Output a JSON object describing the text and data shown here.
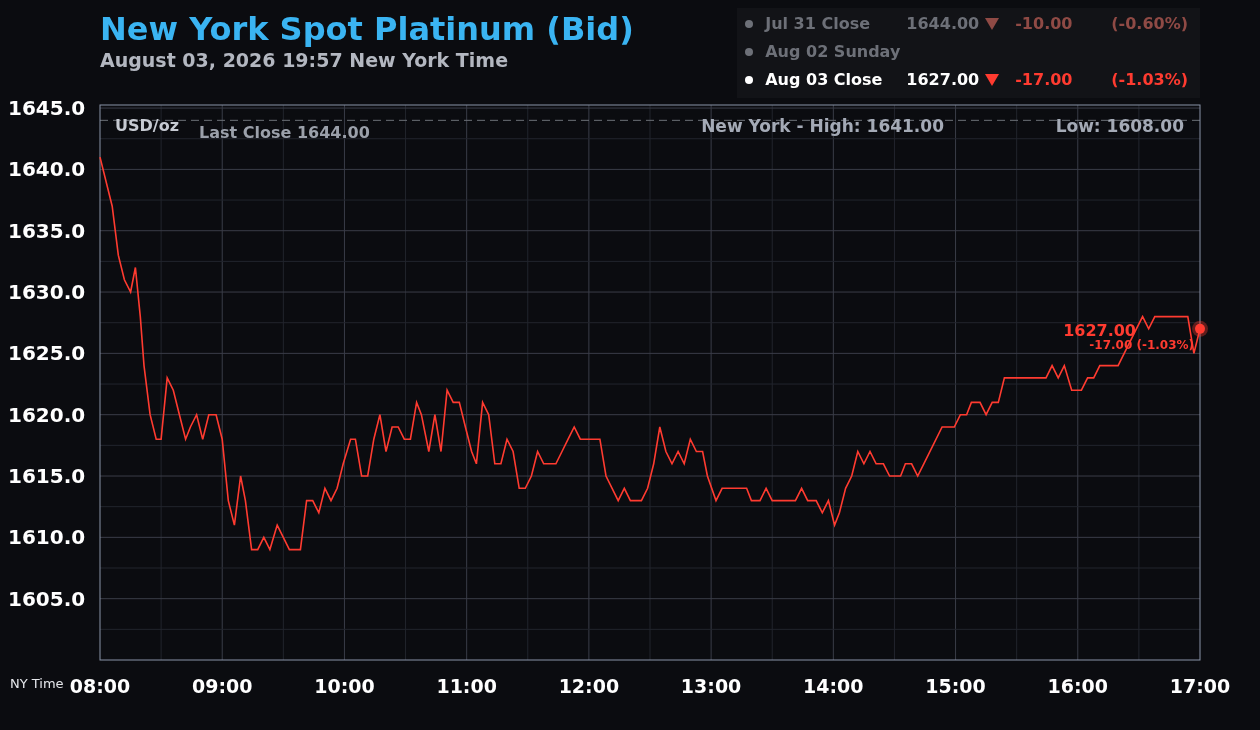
{
  "title": "New York Spot Platinum (Bid)",
  "subtitle": "August 03, 2026 19:57 New York Time",
  "legend": [
    {
      "label": "Jul 31 Close",
      "value": "1644.00",
      "change": "-10.00",
      "percent": "(-0.60%)",
      "active": false
    },
    {
      "label": "Aug 02 Sunday",
      "active": false
    },
    {
      "label": "Aug 03 Close",
      "value": "1627.00",
      "change": "-17.00",
      "percent": "(-1.03%)",
      "active": true
    }
  ],
  "chart": {
    "unit": "USD/oz",
    "high": "New York - High: 1641.00",
    "low": "Low: 1608.00",
    "x_axis_label": "NY Time",
    "end_value": "1627.00",
    "end_change": "-17.00 (-1.03%)",
    "chart_data": {
      "type": "line",
      "xlim": [
        8,
        17
      ],
      "ylim": [
        1600,
        1645.25
      ],
      "xticks": [
        {
          "value": 8,
          "label": "08:00"
        },
        {
          "value": 9,
          "label": "09:00"
        },
        {
          "value": 10,
          "label": "10:00"
        },
        {
          "value": 11,
          "label": "11:00"
        },
        {
          "value": 12,
          "label": "12:00"
        },
        {
          "value": 13,
          "label": "13:00"
        },
        {
          "value": 14,
          "label": "14:00"
        },
        {
          "value": 15,
          "label": "15:00"
        },
        {
          "value": 16,
          "label": "16:00"
        },
        {
          "value": 17,
          "label": "17:00"
        }
      ],
      "yticks": [
        {
          "value": 1605,
          "label": "1605.0"
        },
        {
          "value": 1610,
          "label": "1610.0"
        },
        {
          "value": 1615,
          "label": "1615.0"
        },
        {
          "value": 1620,
          "label": "1620.0"
        },
        {
          "value": 1625,
          "label": "1625.0"
        },
        {
          "value": 1630,
          "label": "1630.0"
        },
        {
          "value": 1635,
          "label": "1635.0"
        },
        {
          "value": 1640,
          "label": "1640.0"
        },
        {
          "value": 1645,
          "label": "1645.0"
        }
      ],
      "grid": true,
      "ref_lines": [
        {
          "axis": "y",
          "value": 1644,
          "label": "Last Close 1644.00"
        }
      ],
      "x": [
        8.0,
        8.1,
        8.15,
        8.2,
        8.25,
        8.29,
        8.33,
        8.36,
        8.41,
        8.46,
        8.5,
        8.55,
        8.6,
        8.65,
        8.7,
        8.74,
        8.79,
        8.84,
        8.89,
        8.95,
        9.0,
        9.05,
        9.1,
        9.15,
        9.19,
        9.24,
        9.29,
        9.34,
        9.39,
        9.45,
        9.5,
        9.55,
        9.64,
        9.69,
        9.74,
        9.79,
        9.84,
        9.89,
        9.94,
        9.99,
        10.05,
        10.09,
        10.14,
        10.19,
        10.24,
        10.29,
        10.34,
        10.39,
        10.44,
        10.49,
        10.54,
        10.59,
        10.63,
        10.69,
        10.74,
        10.79,
        10.84,
        10.89,
        10.94,
        10.99,
        11.04,
        11.08,
        11.13,
        11.18,
        11.23,
        11.28,
        11.33,
        11.38,
        11.43,
        11.48,
        11.53,
        11.58,
        11.63,
        11.73,
        11.78,
        11.83,
        11.88,
        11.93,
        12.09,
        12.14,
        12.19,
        12.24,
        12.29,
        12.34,
        12.43,
        12.48,
        12.53,
        12.58,
        12.63,
        12.68,
        12.73,
        12.78,
        12.83,
        12.88,
        12.93,
        12.97,
        13.04,
        13.09,
        13.29,
        13.33,
        13.4,
        13.45,
        13.5,
        13.69,
        13.74,
        13.79,
        13.86,
        13.91,
        13.96,
        14.01,
        14.05,
        14.1,
        14.15,
        14.2,
        14.25,
        14.3,
        14.35,
        14.41,
        14.46,
        14.55,
        14.59,
        14.64,
        14.69,
        14.74,
        14.89,
        14.99,
        15.04,
        15.09,
        15.13,
        15.2,
        15.25,
        15.3,
        15.35,
        15.4,
        15.74,
        15.79,
        15.84,
        15.89,
        15.95,
        16.03,
        16.08,
        16.13,
        16.18,
        16.33,
        16.38,
        16.43,
        16.48,
        16.53,
        16.58,
        16.63,
        16.9,
        16.95,
        17.0
      ],
      "series": [
        {
          "color": "#ff3b30",
          "values": [
            1641,
            1637,
            1633,
            1631,
            1630,
            1632,
            1628,
            1624,
            1620,
            1618,
            1618,
            1623,
            1622,
            1620,
            1618,
            1619,
            1620,
            1618,
            1620,
            1620,
            1618,
            1613,
            1611,
            1615,
            1613,
            1609,
            1609,
            1610,
            1609,
            1611,
            1610,
            1609,
            1609,
            1613,
            1613,
            1612,
            1614,
            1613,
            1614,
            1616,
            1618,
            1618,
            1615,
            1615,
            1618,
            1620,
            1617,
            1619,
            1619,
            1618,
            1618,
            1621,
            1620,
            1617,
            1620,
            1617,
            1622,
            1621,
            1621,
            1619,
            1617,
            1616,
            1621,
            1620,
            1616,
            1616,
            1618,
            1617,
            1614,
            1614,
            1615,
            1617,
            1616,
            1616,
            1617,
            1618,
            1619,
            1618,
            1618,
            1615,
            1614,
            1613,
            1614,
            1613,
            1613,
            1614,
            1616,
            1619,
            1617,
            1616,
            1617,
            1616,
            1618,
            1617,
            1617,
            1615,
            1613,
            1614,
            1614,
            1613,
            1613,
            1614,
            1613,
            1613,
            1614,
            1613,
            1613,
            1612,
            1613,
            1611,
            1612,
            1614,
            1615,
            1617,
            1616,
            1617,
            1616,
            1616,
            1615,
            1615,
            1616,
            1616,
            1615,
            1616,
            1619,
            1619,
            1620,
            1620,
            1621,
            1621,
            1620,
            1621,
            1621,
            1623,
            1623,
            1624,
            1623,
            1624,
            1622,
            1622,
            1623,
            1623,
            1624,
            1624,
            1625,
            1626,
            1627,
            1628,
            1627,
            1628,
            1628,
            1625,
            1627
          ]
        }
      ]
    }
  }
}
